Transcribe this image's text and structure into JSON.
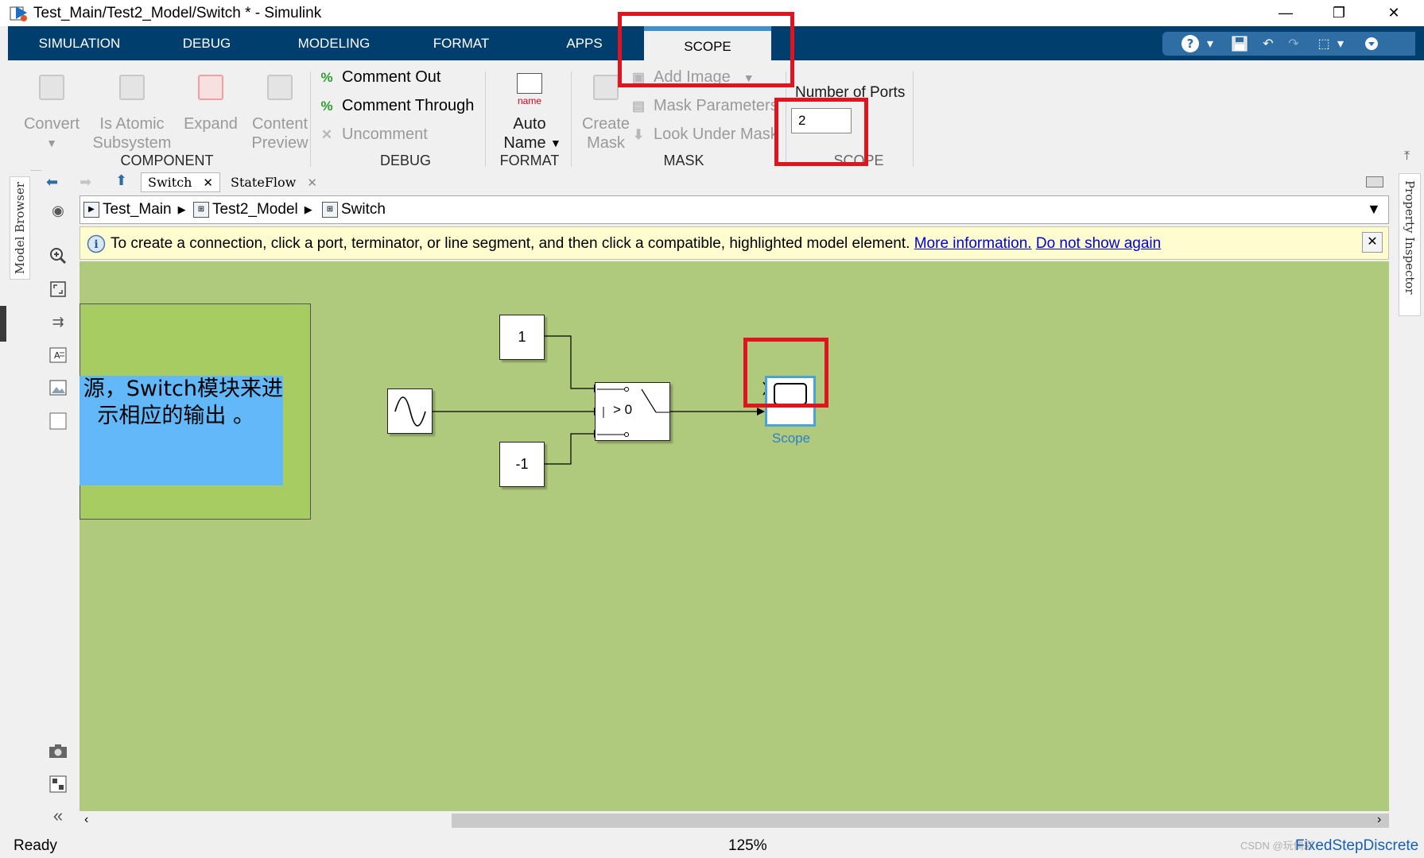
{
  "window": {
    "title": "Test_Main/Test2_Model/Switch * - Simulink",
    "minimize": "—",
    "restore": "❐",
    "close": "✕"
  },
  "menu_tabs": [
    "SIMULATION",
    "DEBUG",
    "MODELING",
    "FORMAT",
    "APPS",
    "SCOPE"
  ],
  "ribbon": {
    "component": {
      "convert": "Convert",
      "is_atomic": [
        "Is Atomic",
        "Subsystem"
      ],
      "expand": "Expand",
      "content_preview": [
        "Content",
        "Preview"
      ],
      "section": "COMPONENT"
    },
    "debug": {
      "comment_out": "Comment Out",
      "comment_through": "Comment Through",
      "uncomment": "Uncomment",
      "section": "DEBUG"
    },
    "format": {
      "icon_text": "name",
      "auto_name": [
        "Auto",
        "Name"
      ],
      "section": "FORMAT"
    },
    "mask": {
      "create_mask": [
        "Create",
        "Mask"
      ],
      "add_image": "Add Image",
      "mask_parameters": "Mask Parameters",
      "look_under_mask": "Look Under Mask",
      "section": "MASK"
    },
    "scope": {
      "ports_label": "Number of Ports",
      "ports_value": "2",
      "section": "SCOPE"
    }
  },
  "left_strip_label": "Model Browser",
  "right_strip_label": "Property Inspector",
  "editor_tabs": [
    "Switch",
    "StateFlow"
  ],
  "breadcrumb": [
    "Test_Main",
    "Test2_Model",
    "Switch"
  ],
  "info_bar": {
    "message": "To create a connection, click a port, terminator, or line segment, and then click a compatible, highlighted model element.",
    "link_more": "More information.",
    "link_dismiss": "Do not show again"
  },
  "canvas": {
    "annotation_line1": "源，Switch模块来进",
    "annotation_line2": "示相应的输出 。",
    "const_top": "1",
    "const_bottom": "-1",
    "switch_label": "> 0",
    "scope_label": "Scope"
  },
  "status": {
    "left": "Ready",
    "zoom": "125%",
    "solver": "FixedStepDiscrete",
    "watermark": "CSDN @玩偶彩"
  },
  "colors": {
    "tabbar": "#003e6e",
    "canvas": "#afca7c",
    "highlight": "#e0141e"
  }
}
